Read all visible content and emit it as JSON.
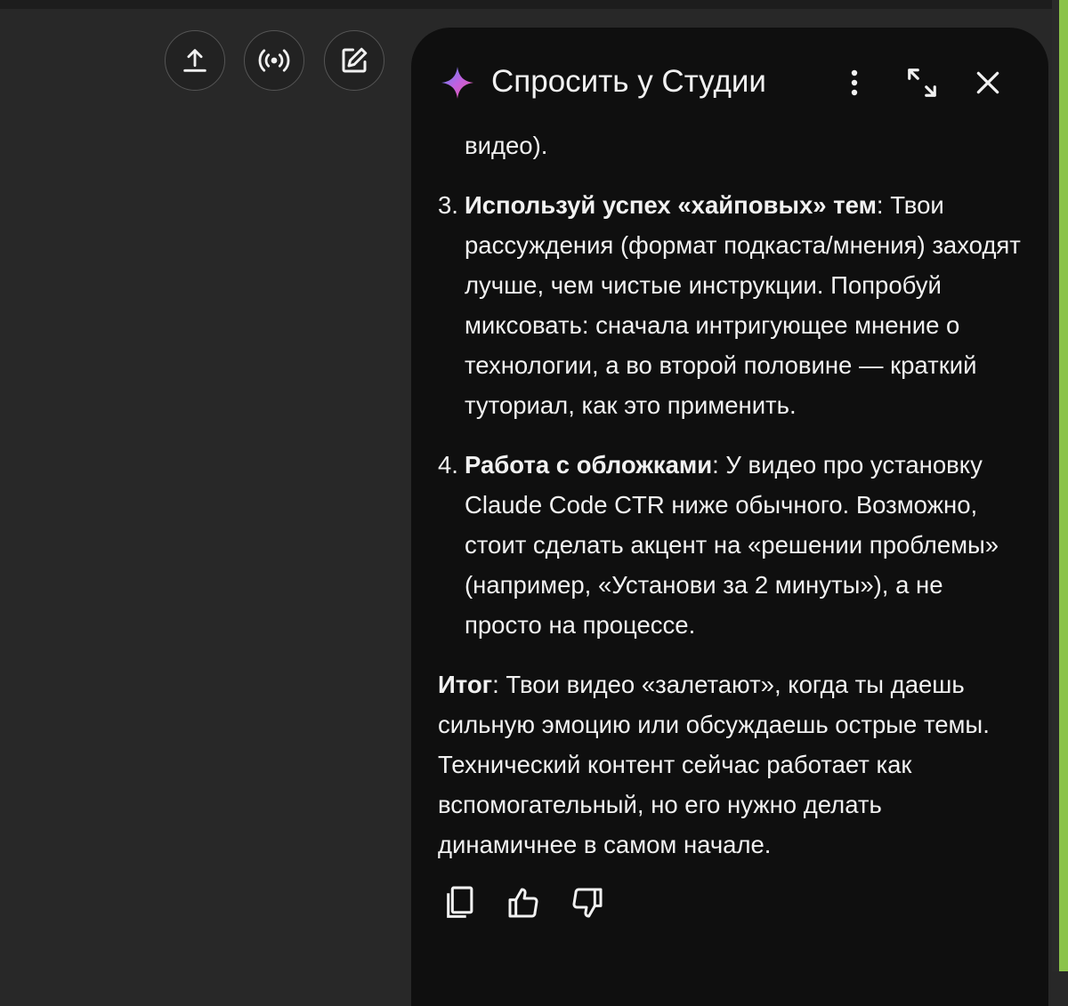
{
  "toolbar": {
    "upload_icon": "upload-icon",
    "live_icon": "live-broadcast-icon",
    "edit_icon": "edit-icon"
  },
  "panel": {
    "title": "Спросить у Студии",
    "icons": [
      "sparkle-icon",
      "more-vert-icon",
      "expand-icon",
      "close-icon"
    ],
    "sparkle_colors": [
      "#4c8df6",
      "#c060e0",
      "#f05a9a"
    ]
  },
  "content": {
    "fragment": "видео).",
    "items": [
      {
        "number": "3.",
        "bold": "Используй успех «хайповых» тем",
        "text": ": Твои рассуждения (формат подкаста/мнения) заходят лучше, чем чистые инструкции. Попробуй миксовать: сначала интригующее мнение о технологии, а во второй половине — краткий туториал, как это применить."
      },
      {
        "number": "4.",
        "bold": "Работа с обложками",
        "text": ": У видео про установку Claude Code CTR ниже обычного. Возможно, стоит сделать акцент на «решении проблемы» (например, «Установи за 2 минуты»), а не просто на процессе."
      }
    ],
    "summary_bold": "Итог",
    "summary_text": ": Твои видео «залетают», когда ты даешь сильную эмоцию или обсуждаешь острые темы. Технический контент сейчас работает как вспомогательный, но его нужно делать динамичнее в самом начале."
  },
  "actions": {
    "icons": [
      "copy-icon",
      "thumbs-up-icon",
      "thumbs-down-icon"
    ]
  },
  "colors": {
    "background": "#282828",
    "panel": "#0f0f0f",
    "text": "#f1f1f1",
    "accent_edge": "#8bc34a"
  }
}
